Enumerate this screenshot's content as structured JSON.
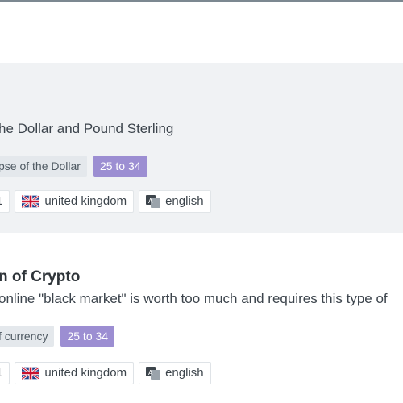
{
  "cards": [
    {
      "title": "",
      "subtitle": "he Dollar and Pound Sterling",
      "tags": {
        "topic": "pse of the Dollar",
        "age": "25 to 34"
      },
      "meta": {
        "count": "1",
        "country": "united kingdom",
        "language": "english"
      },
      "icons": {
        "flag": "uk-flag-icon",
        "language": "translate-icon"
      }
    },
    {
      "title": "n of Crypto",
      "subtitle": " online \"black market\" is worth too much and requires this type of",
      "tags": {
        "topic": "f currency",
        "age": "25 to 34"
      },
      "meta": {
        "count": "1",
        "country": "united kingdom",
        "language": "english"
      },
      "icons": {
        "flag": "uk-flag-icon",
        "language": "translate-icon"
      }
    }
  ],
  "colors": {
    "age_tag": "#9c8ed2",
    "topic_tag": "#e4e8ec",
    "card_highlight": "#f0f2f4"
  }
}
